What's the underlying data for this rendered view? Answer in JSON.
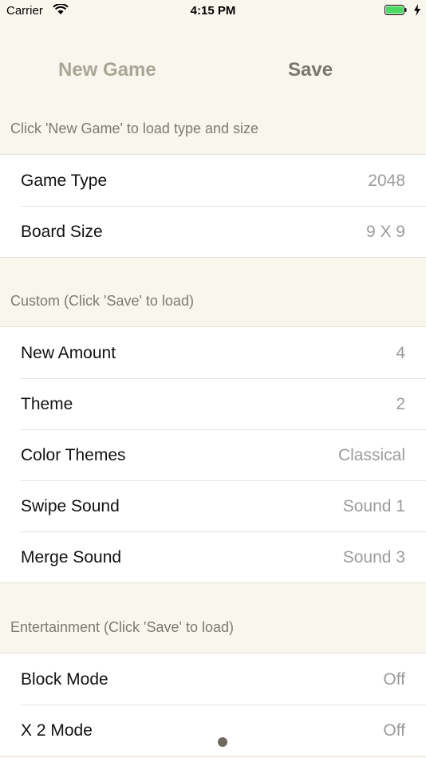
{
  "status_bar": {
    "carrier": "Carrier",
    "time": "4:15 PM"
  },
  "toolbar": {
    "new_game_label": "New Game",
    "save_label": "Save"
  },
  "sections": {
    "game": {
      "header": "Click 'New Game' to load type and size",
      "rows": [
        {
          "label": "Game Type",
          "value": "2048"
        },
        {
          "label": "Board Size",
          "value": "9 X 9"
        }
      ]
    },
    "custom": {
      "header": "Custom  (Click 'Save' to load)",
      "rows": [
        {
          "label": "New Amount",
          "value": "4"
        },
        {
          "label": "Theme",
          "value": "2"
        },
        {
          "label": "Color Themes",
          "value": "Classical"
        },
        {
          "label": "Swipe Sound",
          "value": "Sound 1"
        },
        {
          "label": "Merge Sound",
          "value": "Sound 3"
        }
      ]
    },
    "entertainment": {
      "header": "Entertainment  (Click 'Save' to load)",
      "rows": [
        {
          "label": "Block Mode",
          "value": "Off"
        },
        {
          "label": "X 2 Mode",
          "value": "Off"
        }
      ]
    }
  },
  "icons": [
    "wifi-icon",
    "battery-icon",
    "charging-bolt-icon"
  ],
  "colors": {
    "background": "#f9f6ee",
    "accent": "#7a776b",
    "battery": "#4cd964"
  }
}
